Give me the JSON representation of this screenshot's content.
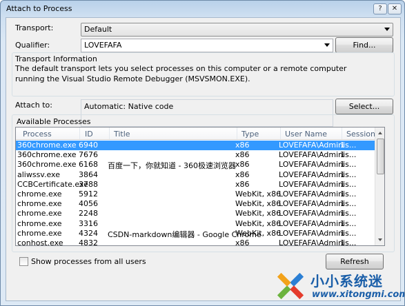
{
  "window": {
    "title": "Attach to Process",
    "help_label": "?",
    "close_label": "✕"
  },
  "transport": {
    "label": "Transport:",
    "value": "Default"
  },
  "qualifier": {
    "label": "Qualifier:",
    "value": "LOVEFAFA",
    "find_label": "Find..."
  },
  "transport_info": {
    "title": "Transport Information",
    "text": "The default transport lets you select processes on this computer or a remote computer running the Visual Studio Remote Debugger (MSVSMON.EXE)."
  },
  "attach_to": {
    "label": "Attach to:",
    "value": "Automatic: Native code",
    "select_label": "Select..."
  },
  "available": {
    "label": "Available Processes",
    "columns": [
      "Process",
      "ID",
      "Title",
      "Type",
      "User Name",
      "Session"
    ],
    "rows": [
      [
        "360chrome.exe",
        "6940",
        "",
        "x86",
        "LOVEFAFA\\Adminis...",
        "1"
      ],
      [
        "360chrome.exe",
        "7676",
        "",
        "x86",
        "LOVEFAFA\\Adminis...",
        "1"
      ],
      [
        "360chrome.exe",
        "6168",
        "百度一下，你就知道 - 360极速浏览器",
        "x86",
        "LOVEFAFA\\Adminis...",
        "1"
      ],
      [
        "aliwssv.exe",
        "3864",
        "",
        "x86",
        "LOVEFAFA\\Adminis...",
        "1"
      ],
      [
        "CCBCertificate.exe",
        "3788",
        "",
        "x86",
        "LOVEFAFA\\Adminis...",
        "1"
      ],
      [
        "chrome.exe",
        "5912",
        "",
        "WebKit, x86",
        "LOVEFAFA\\Adminis...",
        "1"
      ],
      [
        "chrome.exe",
        "4056",
        "",
        "WebKit, x86",
        "LOVEFAFA\\Adminis...",
        "1"
      ],
      [
        "chrome.exe",
        "2248",
        "",
        "WebKit, x86",
        "LOVEFAFA\\Adminis...",
        "1"
      ],
      [
        "chrome.exe",
        "3316",
        "",
        "WebKit, x86",
        "LOVEFAFA\\Adminis...",
        "1"
      ],
      [
        "chrome.exe",
        "4324",
        "CSDN-markdown编辑器 - Google Chrome",
        "WebKit, x86",
        "LOVEFAFA\\Adminis...",
        "1"
      ],
      [
        "conhost.exe",
        "4832",
        "",
        "x86",
        "LOVEFAFA\\Adminis...",
        "1"
      ]
    ]
  },
  "show_all": {
    "label": "Show processes from all users",
    "checked": false
  },
  "refresh_label": "Refresh",
  "watermark": {
    "main": "小小系统迷",
    "url": "www.xitongmi.com"
  }
}
